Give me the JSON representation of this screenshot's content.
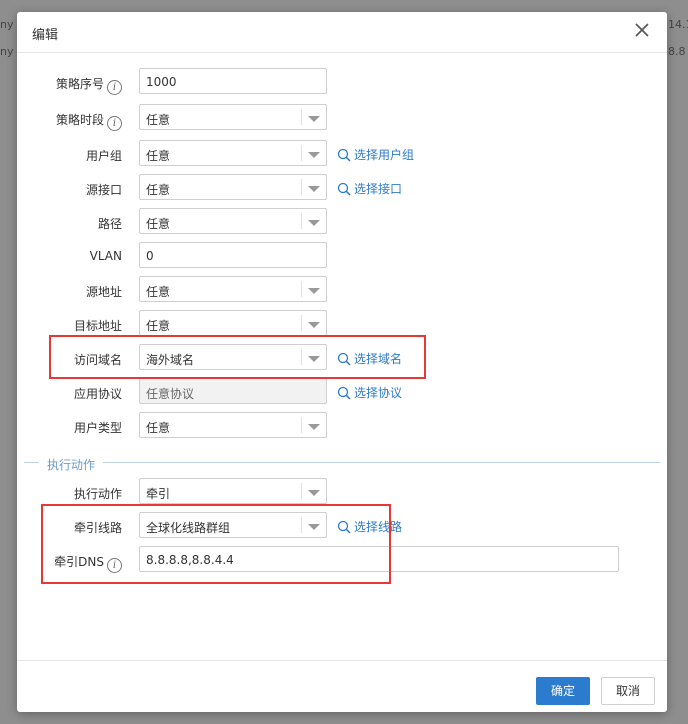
{
  "background": {
    "row1_right": "14.1",
    "row2_right": "8.8",
    "row1_left": "ny",
    "row2_left": "ny"
  },
  "dialog": {
    "title": "编辑",
    "fields": {
      "priority": {
        "label": "策略序号",
        "value": "1000"
      },
      "schedule": {
        "label": "策略时段",
        "value": "任意"
      },
      "user_group": {
        "label": "用户组",
        "value": "任意",
        "link": "选择用户组"
      },
      "src_interface": {
        "label": "源接口",
        "value": "任意",
        "link": "选择接口"
      },
      "path": {
        "label": "路径",
        "value": "任意"
      },
      "vlan": {
        "label": "VLAN",
        "value": "0"
      },
      "src_addr": {
        "label": "源地址",
        "value": "任意"
      },
      "dst_addr": {
        "label": "目标地址",
        "value": "任意"
      },
      "domain": {
        "label": "访问域名",
        "value": "海外域名",
        "link": "选择域名"
      },
      "protocol": {
        "label": "应用协议",
        "value": "任意协议",
        "link": "选择协议"
      },
      "user_type": {
        "label": "用户类型",
        "value": "任意"
      }
    },
    "action_section": "执行动作",
    "action": {
      "action": {
        "label": "执行动作",
        "value": "牵引"
      },
      "line": {
        "label": "牵引线路",
        "value": "全球化线路群组",
        "link": "选择线路"
      },
      "dns": {
        "label": "牵引DNS",
        "value": "8.8.8.8,8.8.4.4"
      }
    },
    "buttons": {
      "ok": "确定",
      "cancel": "取消"
    }
  },
  "colors": {
    "accent": "#2b7bcf",
    "highlight": "#e53935"
  }
}
